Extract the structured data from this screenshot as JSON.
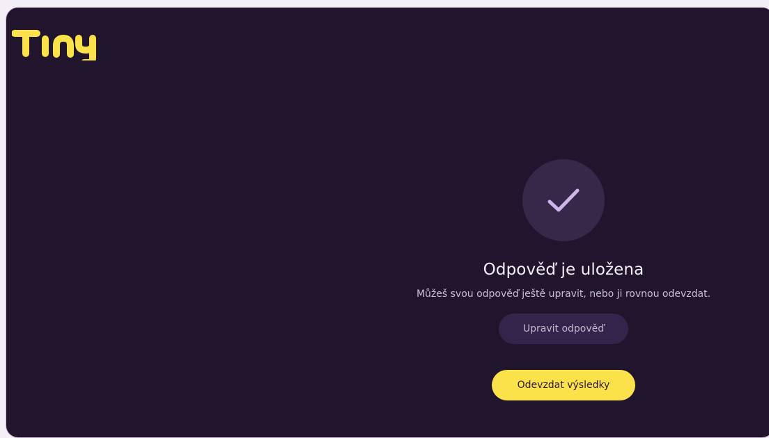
{
  "brand": {
    "logo_text": "Tiny",
    "logo_color": "#fbe24b"
  },
  "colors": {
    "background": "#21142d",
    "accent": "#fbe24b",
    "circle": "#362848",
    "secondary_button": "#32244a"
  },
  "confirmation": {
    "icon": "check-icon",
    "title": "Odpověď je uložena",
    "subtitle": "Můžeš svou odpověď ještě upravit, nebo ji rovnou odevzdat.",
    "edit_label": "Upravit odpověď",
    "submit_label": "Odevzdat výsledky"
  }
}
